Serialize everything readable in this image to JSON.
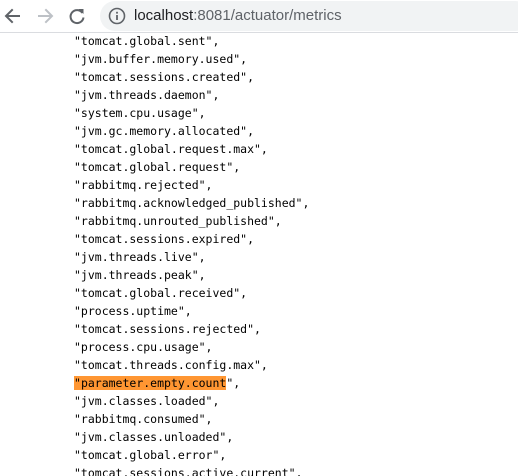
{
  "browser": {
    "url_host": "localhost",
    "url_rest": ":8081/actuator/metrics"
  },
  "icons": {
    "back": "arrow-back-icon",
    "forward": "arrow-forward-icon",
    "reload": "reload-icon",
    "info": "info-icon"
  },
  "colors": {
    "find_highlight": "#ff9632",
    "omnibox_bg": "#f1f3f4"
  },
  "metrics": {
    "items": [
      "\"tomcat.global.sent\",",
      "\"jvm.buffer.memory.used\",",
      "\"tomcat.sessions.created\",",
      "\"jvm.threads.daemon\",",
      "\"system.cpu.usage\",",
      "\"jvm.gc.memory.allocated\",",
      "\"tomcat.global.request.max\",",
      "\"tomcat.global.request\",",
      "\"rabbitmq.rejected\",",
      "\"rabbitmq.acknowledged_published\",",
      "\"rabbitmq.unrouted_published\",",
      "\"tomcat.sessions.expired\",",
      "\"jvm.threads.live\",",
      "\"jvm.threads.peak\",",
      "\"tomcat.global.received\",",
      "\"process.uptime\",",
      "\"tomcat.sessions.rejected\",",
      "\"process.cpu.usage\",",
      "\"tomcat.threads.config.max\","
    ],
    "highlighted": {
      "open_quote": "\"",
      "text": "parameter.empty.count",
      "close": "\","
    },
    "items_after": [
      "\"jvm.classes.loaded\",",
      "\"rabbitmq.consumed\",",
      "\"jvm.classes.unloaded\",",
      "\"tomcat.global.error\",",
      "\"tomcat.sessions.active.current\","
    ]
  }
}
